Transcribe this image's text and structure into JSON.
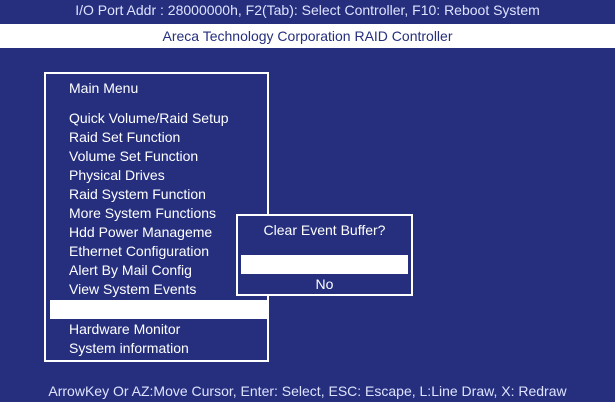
{
  "header": {
    "top_line": "I/O Port Addr : 28000000h, F2(Tab): Select Controller, F10: Reboot System",
    "title": "Areca Technology Corporation RAID Controller"
  },
  "main_menu": {
    "title": "Main Menu",
    "items": [
      {
        "label": "Quick Volume/Raid Setup"
      },
      {
        "label": "Raid Set Function"
      },
      {
        "label": "Volume Set Function"
      },
      {
        "label": "Physical Drives"
      },
      {
        "label": "Raid System Function"
      },
      {
        "label": "More System Functions"
      },
      {
        "label": "Hdd Power Manageme"
      },
      {
        "label": "Ethernet Configuration"
      },
      {
        "label": "Alert By Mail Config"
      },
      {
        "label": "View System Events"
      },
      {
        "label": ""
      },
      {
        "label": "Hardware Monitor"
      },
      {
        "label": "System information"
      }
    ]
  },
  "dialog": {
    "title": "Clear Event Buffer?",
    "yes_label": "",
    "no_label": "No"
  },
  "status_bar": {
    "text": "ArrowKey Or AZ:Move Cursor, Enter: Select, ESC: Escape, L:Line Draw, X: Redraw"
  },
  "colors": {
    "background": "#252f7e",
    "highlight": "#ffffff",
    "text": "#ffffff"
  }
}
